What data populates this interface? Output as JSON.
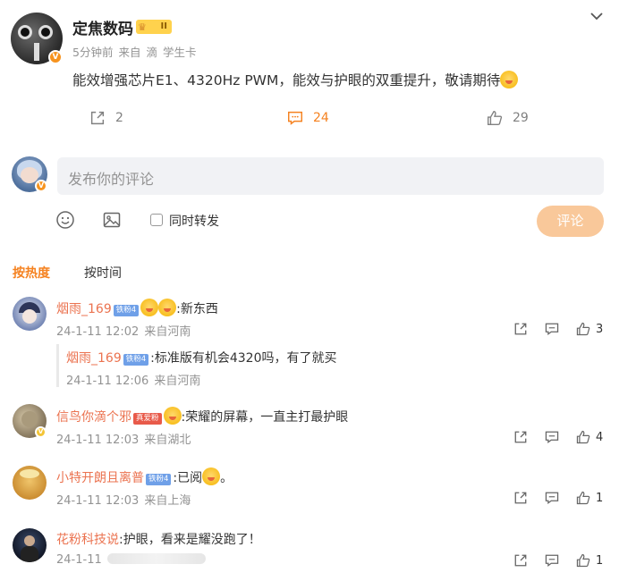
{
  "post": {
    "author": "定焦数码",
    "vip_level": "II",
    "meta": [
      "5分钟前",
      "来自",
      "滴",
      "学生卡"
    ],
    "content": "能效增强芯片E1、4320Hz PWM，能效与护眼的双重提升，敬请期待",
    "reposts": "2",
    "comments": "24",
    "likes": "29"
  },
  "composer": {
    "placeholder": "发布你的评论",
    "sync_label": "同时转发",
    "submit_label": "评论"
  },
  "sort_tabs": [
    "按热度",
    "按时间"
  ],
  "comments": [
    {
      "name": "烟雨_169",
      "badge": "铁粉4",
      "text": ":新东西",
      "date": "24-1-11 12:02",
      "location": "来自河南",
      "likes": "3",
      "reply": {
        "name": "烟雨_169",
        "badge": "铁粉4",
        "text": ":标准版有机会4320吗，有了就买",
        "date": "24-1-11 12:06",
        "location": "来自河南"
      }
    },
    {
      "name": "信鸟你滴个邪",
      "badge": "真爱粉",
      "text": ":荣耀的屏幕，一直主打最护眼",
      "date": "24-1-11 12:03",
      "location": "来自湖北",
      "likes": "4"
    },
    {
      "name": "小特开朗且离普",
      "badge": "铁粉4",
      "text": ":已阅",
      "text_tail": "。",
      "date": "24-1-11 12:03",
      "location": "来自上海",
      "likes": "1"
    },
    {
      "name": "花粉科技说",
      "text": ":护眼，看来是耀没跑了！",
      "date": "24-1-11",
      "likes": "1"
    }
  ],
  "colors": {
    "accent": "#f58220",
    "name": "#eb7350",
    "meta": "#939393",
    "submit_disabled": "#f9c89a"
  }
}
